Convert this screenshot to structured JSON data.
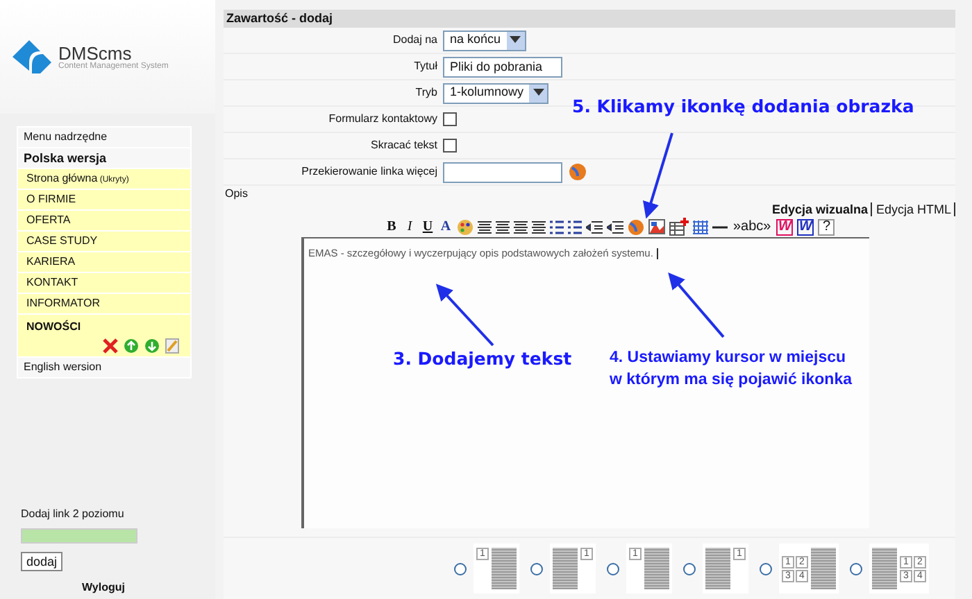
{
  "logo": {
    "name": "DMScms",
    "tagline": "Content Management System"
  },
  "sidebar": {
    "parent_link": "Menu nadrzędne",
    "section": "Polska wersja",
    "items": [
      {
        "label": "Strona główna",
        "note": "(Ukryty)",
        "selected": false
      },
      {
        "label": "O FIRMIE",
        "selected": false
      },
      {
        "label": "OFERTA",
        "selected": false
      },
      {
        "label": "CASE STUDY",
        "selected": false
      },
      {
        "label": "KARIERA",
        "selected": false
      },
      {
        "label": "KONTAKT",
        "selected": false
      },
      {
        "label": "INFORMATOR",
        "selected": false
      },
      {
        "label": "NOWOŚCI",
        "selected": true
      }
    ],
    "other_version": "English wersion",
    "add_label": "Dodaj link 2 poziomu",
    "add_button": "dodaj",
    "logout": "Wyloguj"
  },
  "panel": {
    "title": "Zawartość - dodaj",
    "fields": [
      {
        "kind": "select",
        "label": "Dodaj na",
        "value": "na końcu"
      },
      {
        "kind": "text",
        "label": "Tytuł",
        "value": "Pliki do pobrania"
      },
      {
        "kind": "select",
        "label": "Tryb",
        "value": "1-kolumnowy"
      },
      {
        "kind": "checkbox",
        "label": "Formularz kontaktowy",
        "checked": false
      },
      {
        "kind": "checkbox",
        "label": "Skracać tekst",
        "checked": false
      },
      {
        "kind": "link",
        "label": "Przekierowanie linka więcej"
      }
    ],
    "description_label": "Opis",
    "editor_tabs": [
      {
        "label": "Edycja wizualna",
        "selected": true
      },
      {
        "label": "Edycja HTML",
        "selected": false
      }
    ],
    "toolbar": [
      {
        "kind": "bold",
        "label": "B"
      },
      {
        "kind": "italic",
        "label": "I"
      },
      {
        "kind": "underline",
        "label": "U"
      },
      {
        "kind": "font-color",
        "label": "A"
      },
      {
        "kind": "palette"
      },
      {
        "kind": "align"
      },
      {
        "kind": "align"
      },
      {
        "kind": "align"
      },
      {
        "kind": "align"
      },
      {
        "kind": "bullets"
      },
      {
        "kind": "bullets"
      },
      {
        "kind": "indent"
      },
      {
        "kind": "indent"
      },
      {
        "kind": "link"
      },
      {
        "kind": "image"
      },
      {
        "kind": "table-add"
      },
      {
        "kind": "grid"
      },
      {
        "kind": "rule"
      },
      {
        "kind": "spell",
        "label": "»abc»"
      },
      {
        "kind": "word-red",
        "label": "W"
      },
      {
        "kind": "word-blue",
        "label": "W"
      },
      {
        "kind": "help",
        "label": "?"
      }
    ],
    "editor_text": "EMAS - szczegółowy i wyczerpujący opis podstawowych założeń systemu.",
    "layouts": [
      {
        "kind": "image-left",
        "numbers": [
          "1"
        ],
        "selected": false
      },
      {
        "kind": "image-right",
        "numbers": [
          "1"
        ],
        "selected": false
      },
      {
        "kind": "image-left",
        "numbers": [
          "1"
        ],
        "selected": false
      },
      {
        "kind": "image-right",
        "numbers": [
          "1"
        ],
        "selected": false
      },
      {
        "kind": "grid-left",
        "numbers": [
          "1",
          "2",
          "3",
          "4"
        ],
        "selected": false
      },
      {
        "kind": "grid-right",
        "numbers": [
          "1",
          "2",
          "3",
          "4"
        ],
        "selected": false
      }
    ]
  },
  "annotations": [
    {
      "text": "5. Klikamy ikonkę dodania obrazka"
    },
    {
      "text": "3. Dodajemy tekst"
    },
    {
      "lines": [
        "4. Ustawiamy kursor w miejscu",
        "w którym ma się pojawić ikonka"
      ]
    }
  ]
}
